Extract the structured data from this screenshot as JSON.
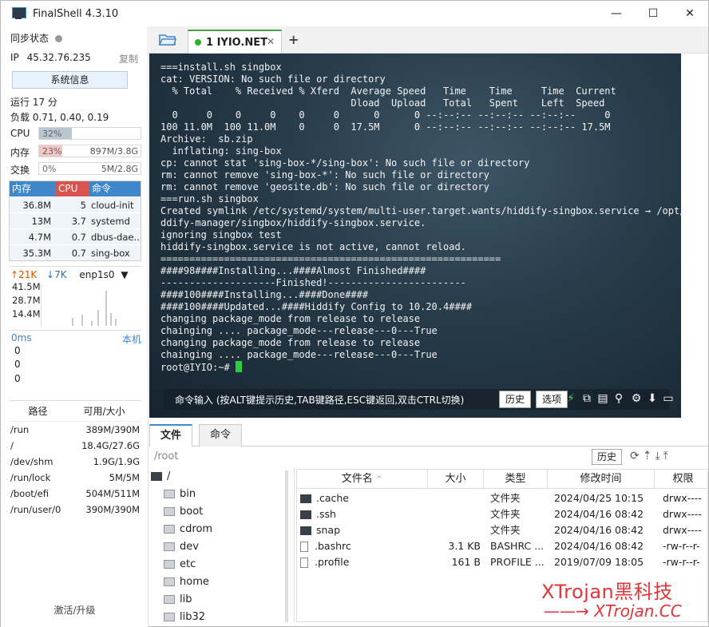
{
  "window": {
    "title": "FinalShell 4.3.10",
    "minimize": "—",
    "maximize": "☐",
    "close": "✕"
  },
  "left": {
    "sync_label": "同步状态",
    "ip_label": "IP",
    "ip_value": "45.32.76.235",
    "copy_label": "复制",
    "sysinfo_button": "系统信息",
    "uptime": "运行 17 分",
    "load": "负载 0.71, 0.40, 0.19",
    "cpu": {
      "label": "CPU",
      "pct": "32%",
      "fraction": 0.32
    },
    "mem": {
      "label": "内存",
      "pct": "23%",
      "value": "897M/3.8G",
      "fraction": 0.23
    },
    "swap": {
      "label": "交换",
      "pct": "0%",
      "value": "5M/2.8G",
      "fraction": 0.0
    },
    "proc_headers": [
      "内存",
      "CPU",
      "命令"
    ],
    "processes": [
      {
        "mem": "36.8M",
        "cpu": "5",
        "cmd": "cloud-init"
      },
      {
        "mem": "13M",
        "cpu": "3.7",
        "cmd": "systemd"
      },
      {
        "mem": "4.7M",
        "cpu": "0.7",
        "cmd": "dbus-dae..."
      },
      {
        "mem": "35.3M",
        "cpu": "0.7",
        "cmd": "sing-box"
      }
    ],
    "net_up": "↑21K",
    "net_down": "↓7K",
    "net_iface": "enp1s0",
    "net_ticks": [
      "41.5M",
      "28.7M",
      "14.4M"
    ],
    "ping_label": "0ms",
    "ping_host": "本机",
    "ping_values": [
      "0",
      "0",
      "0"
    ],
    "disk_headers": [
      "路径",
      "可用/大小"
    ],
    "disks": [
      {
        "path": "/run",
        "size": "389M/390M"
      },
      {
        "path": "/",
        "size": "18.4G/27.6G"
      },
      {
        "path": "/dev/shm",
        "size": "1.9G/1.9G"
      },
      {
        "path": "/run/lock",
        "size": "5M/5M"
      },
      {
        "path": "/boot/efi",
        "size": "504M/511M"
      },
      {
        "path": "/run/user/0",
        "size": "390M/390M"
      }
    ],
    "activate": "激活/升级"
  },
  "tabs": {
    "session_label": "1 IYIO.NET",
    "close": "✕",
    "add": "+"
  },
  "terminal": {
    "lines": [
      "===install.sh singbox",
      "cat: VERSION: No such file or directory",
      "  % Total    % Received % Xferd  Average Speed   Time    Time     Time  Current",
      "                                 Dload  Upload   Total   Spent    Left  Speed",
      "  0     0    0     0    0     0      0      0 --:--:-- --:--:-- --:--:--     0",
      "100 11.0M  100 11.0M    0     0  17.5M      0 --:--:-- --:--:-- --:--:-- 17.5M",
      "Archive:  sb.zip",
      "  inflating: sing-box",
      "cp: cannot stat 'sing-box-*/sing-box': No such file or directory",
      "rm: cannot remove 'sing-box-*': No such file or directory",
      "rm: cannot remove 'geosite.db': No such file or directory",
      "===run.sh singbox",
      "Created symlink /etc/systemd/system/multi-user.target.wants/hiddify-singbox.service → /opt/hi",
      "ddify-manager/singbox/hiddify-singbox.service.",
      "ignoring singbox test",
      "hiddify-singbox.service is not active, cannot reload.",
      "===========================================================",
      "####98####Installing...####Almost Finished####",
      "--------------------Finished!------------------------",
      "####100####Installing...####Done####",
      "####100####Updated...####Hiddify Config to 10.20.4####",
      "changing package_mode from release to release",
      "chainging .... package_mode---release---0---True",
      "changing package_mode from release to release",
      "chainging .... package_mode---release---0---True"
    ],
    "prompt": "root@IYIO:~# ",
    "cmd_hint": "命令输入 (按ALT键提示历史,TAB键路径,ESC键返回,双击CTRL切换)",
    "history_button": "历史",
    "options_button": "选项"
  },
  "files": {
    "tab_files": "文件",
    "tab_commands": "命令",
    "path": "/root",
    "history_button": "历史",
    "tree": [
      "/",
      "bin",
      "boot",
      "cdrom",
      "dev",
      "etc",
      "home",
      "lib",
      "lib32"
    ],
    "columns": [
      "文件名",
      "大小",
      "类型",
      "修改时间",
      "权限"
    ],
    "rows": [
      {
        "name": ".cache",
        "size": "",
        "type": "文件夹",
        "mtime": "2024/04/25 10:15",
        "perm": "drwx----",
        "folder": true
      },
      {
        "name": ".ssh",
        "size": "",
        "type": "文件夹",
        "mtime": "2024/04/16 08:42",
        "perm": "drwx----",
        "folder": true
      },
      {
        "name": "snap",
        "size": "",
        "type": "文件夹",
        "mtime": "2024/04/16 08:42",
        "perm": "drwx----",
        "folder": true
      },
      {
        "name": ".bashrc",
        "size": "3.1 KB",
        "type": "BASHRC ...",
        "mtime": "2024/04/16 08:42",
        "perm": "-rw-r--r-",
        "folder": false
      },
      {
        "name": ".profile",
        "size": "161 B",
        "type": "PROFILE ...",
        "mtime": "2019/07/09 18:05",
        "perm": "-rw-r--r-",
        "folder": false
      }
    ]
  },
  "watermark": {
    "line1": "XTrojan黑科技",
    "line2": "——→ XTrojan.CC"
  },
  "colors": {
    "accent": "#3e87c9",
    "cpu_header": "#d9534f",
    "cursor": "#2ecc40",
    "watermark": "#e0353b"
  }
}
